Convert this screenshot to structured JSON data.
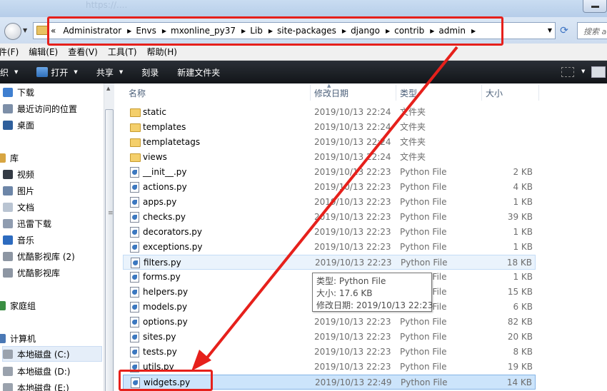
{
  "window": {
    "url_fragment": "https://...."
  },
  "address": {
    "breadcrumbs": [
      "Administrator",
      "Envs",
      "mxonline_py37",
      "Lib",
      "site-packages",
      "django",
      "contrib",
      "admin"
    ],
    "search_placeholder": "搜索 admin"
  },
  "menu": {
    "items": [
      "件(F)",
      "编辑(E)",
      "查看(V)",
      "工具(T)",
      "帮助(H)"
    ]
  },
  "toolbar": {
    "organize": "组织",
    "open": "打开",
    "share": "共享",
    "burn": "刻录",
    "new_folder": "新建文件夹"
  },
  "nav": {
    "items": [
      {
        "label": "下载",
        "color": "#3f7fd0"
      },
      {
        "label": "最近访问的位置",
        "color": "#7d8fa8"
      },
      {
        "label": "桌面",
        "color": "#2f5f9c"
      },
      {
        "label": "库",
        "color": "#d7a542"
      },
      {
        "label": "视频",
        "color": "#333a44"
      },
      {
        "label": "图片",
        "color": "#6d86a8"
      },
      {
        "label": "文档",
        "color": "#b9c4d2"
      },
      {
        "label": "迅雷下载",
        "color": "#8f9cb0"
      },
      {
        "label": "音乐",
        "color": "#2d6bbf"
      },
      {
        "label": "优酷影视库 (2)",
        "color": "#8d96a3"
      },
      {
        "label": "优酷影视库",
        "color": "#8d96a3"
      },
      {
        "label": "家庭组",
        "color": "#3a8e43"
      },
      {
        "label": "计算机",
        "color": "#4a78b5"
      },
      {
        "label": "本地磁盘 (C:)",
        "color": "#9aa2ad"
      },
      {
        "label": "本地磁盘 (D:)",
        "color": "#9aa2ad"
      },
      {
        "label": "本地磁盘 (E:)",
        "color": "#9aa2ad"
      }
    ]
  },
  "columns": {
    "name": "名称",
    "date": "修改日期",
    "type": "类型",
    "size": "大小"
  },
  "files": [
    {
      "name": "static",
      "date": "2019/10/13 22:24",
      "type": "文件夹",
      "size": "",
      "kind": "folder"
    },
    {
      "name": "templates",
      "date": "2019/10/13 22:24",
      "type": "文件夹",
      "size": "",
      "kind": "folder"
    },
    {
      "name": "templatetags",
      "date": "2019/10/13 22:24",
      "type": "文件夹",
      "size": "",
      "kind": "folder"
    },
    {
      "name": "views",
      "date": "2019/10/13 22:24",
      "type": "文件夹",
      "size": "",
      "kind": "folder"
    },
    {
      "name": "__init__.py",
      "date": "2019/10/13 22:23",
      "type": "Python File",
      "size": "2 KB",
      "kind": "py"
    },
    {
      "name": "actions.py",
      "date": "2019/10/13 22:23",
      "type": "Python File",
      "size": "4 KB",
      "kind": "py"
    },
    {
      "name": "apps.py",
      "date": "2019/10/13 22:23",
      "type": "Python File",
      "size": "1 KB",
      "kind": "py"
    },
    {
      "name": "checks.py",
      "date": "2019/10/13 22:23",
      "type": "Python File",
      "size": "39 KB",
      "kind": "py"
    },
    {
      "name": "decorators.py",
      "date": "2019/10/13 22:23",
      "type": "Python File",
      "size": "1 KB",
      "kind": "py"
    },
    {
      "name": "exceptions.py",
      "date": "2019/10/13 22:23",
      "type": "Python File",
      "size": "1 KB",
      "kind": "py"
    },
    {
      "name": "filters.py",
      "date": "2019/10/13 22:23",
      "type": "Python File",
      "size": "18 KB",
      "kind": "py",
      "state": "hover"
    },
    {
      "name": "forms.py",
      "date": "2019/10/13 22:23",
      "type": "Python File",
      "size": "1 KB",
      "kind": "py"
    },
    {
      "name": "helpers.py",
      "date": "2019/10/13 22:23",
      "type": "Python File",
      "size": "15 KB",
      "kind": "py"
    },
    {
      "name": "models.py",
      "date": "2019/10/13 22:23",
      "type": "Python File",
      "size": "6 KB",
      "kind": "py"
    },
    {
      "name": "options.py",
      "date": "2019/10/13 22:23",
      "type": "Python File",
      "size": "82 KB",
      "kind": "py"
    },
    {
      "name": "sites.py",
      "date": "2019/10/13 22:23",
      "type": "Python File",
      "size": "20 KB",
      "kind": "py"
    },
    {
      "name": "tests.py",
      "date": "2019/10/13 22:23",
      "type": "Python File",
      "size": "8 KB",
      "kind": "py"
    },
    {
      "name": "utils.py",
      "date": "2019/10/13 22:23",
      "type": "Python File",
      "size": "19 KB",
      "kind": "py"
    },
    {
      "name": "widgets.py",
      "date": "2019/10/13 22:49",
      "type": "Python File",
      "size": "14 KB",
      "kind": "py",
      "state": "selected"
    }
  ],
  "tooltip": {
    "type_line": "类型: Python File",
    "size_line": "大小: 17.6 KB",
    "date_line": "修改日期: 2019/10/13 22:23"
  },
  "colors": {
    "annotation_red": "#e6201b",
    "toolbar_dark": "#1c2026",
    "selection_blue": "#cce4fb"
  }
}
